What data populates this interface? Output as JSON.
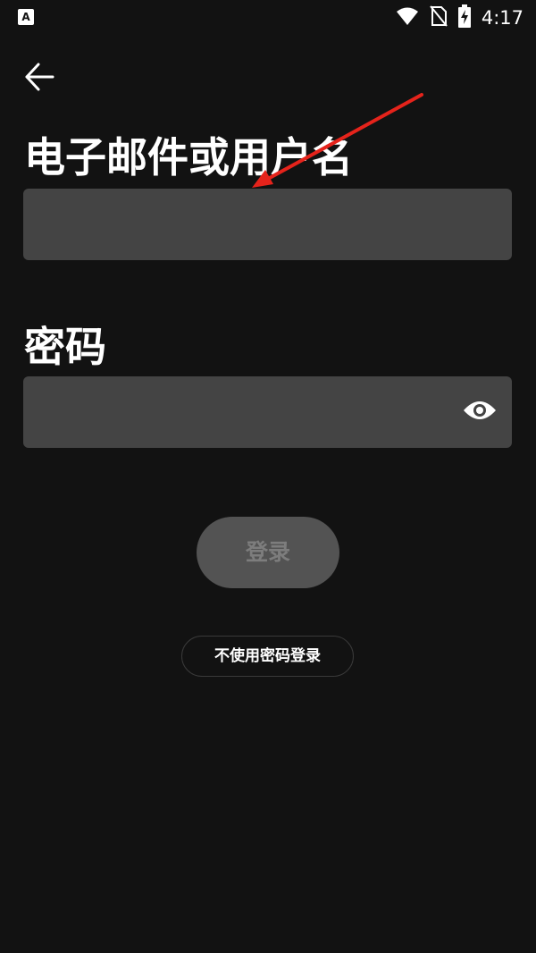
{
  "status_bar": {
    "left_badge": "A",
    "time": "4:17",
    "icons": [
      "wifi-icon",
      "no-sim-icon",
      "battery-charging-icon"
    ]
  },
  "header": {
    "back_icon": "arrow-left-icon"
  },
  "form": {
    "email_label": "电子邮件或用户名",
    "email_value": "",
    "password_label": "密码",
    "password_value": "",
    "password_toggle_icon": "eye-icon",
    "login_label": "登录",
    "passwordless_label": "不使用密码登录"
  },
  "colors": {
    "background": "#121212",
    "field_background": "#444444",
    "button_disabled_bg": "#535353",
    "button_disabled_text": "#7d7d7d",
    "annotation_arrow": "#e5231b"
  }
}
